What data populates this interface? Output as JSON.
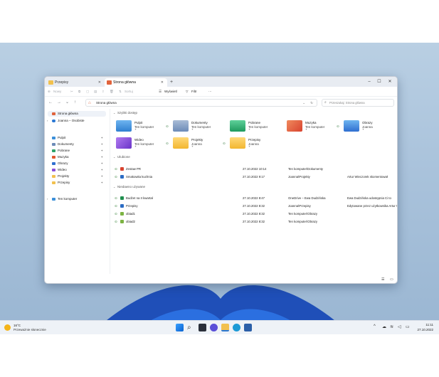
{
  "window": {
    "tabs": [
      {
        "label": "Przepisy",
        "color": "#f2c14e"
      },
      {
        "label": "Strona główna",
        "color": "#e0633c"
      }
    ],
    "new_tab": "+",
    "controls": {
      "minimize": "–",
      "maximize": "☐",
      "close": "✕"
    }
  },
  "commandbar": {
    "new": "Nowy",
    "sort": "Sortuj",
    "view": "Wyświetl",
    "filter": "Filtr",
    "more": "···"
  },
  "address": {
    "path": "Strona główna",
    "search_placeholder": "Przeszukaj: Strona główna"
  },
  "sidebar": {
    "home": "Strona główna",
    "account": "Joanna – Osobiste",
    "quick": [
      {
        "label": "Pulpit",
        "color": "#3b8fd9"
      },
      {
        "label": "Dokumenty",
        "color": "#6c8bb8"
      },
      {
        "label": "Pobrane",
        "color": "#2fa36b"
      },
      {
        "label": "Muzyka",
        "color": "#e0572f"
      },
      {
        "label": "Obrazy",
        "color": "#2f6fd0"
      },
      {
        "label": "Wideo",
        "color": "#8a4fd8"
      },
      {
        "label": "Projekty",
        "color": "#f2c14e"
      },
      {
        "label": "Przepisy",
        "color": "#f2c14e"
      }
    ],
    "computer": "Ten komputer"
  },
  "sections": {
    "quick_access": "Szybki dostęp",
    "favorites": "Ulubione",
    "recent": "Niedawno używane"
  },
  "quick_tiles": [
    {
      "name": "Pulpit",
      "sub": "Ten komputer",
      "color": "#3b8fd9"
    },
    {
      "name": "Dokumenty",
      "sub": "Ten komputer",
      "color": "#6c8bb8"
    },
    {
      "name": "Pobrane",
      "sub": "Ten komputer",
      "color": "#2fa36b"
    },
    {
      "name": "Muzyka",
      "sub": "Ten komputer",
      "color": "#e0572f"
    },
    {
      "name": "Obrazy",
      "sub": "Joanna",
      "color": "#2f6fd0"
    },
    {
      "name": "Wideo",
      "sub": "Ten komputer",
      "color": "#8a4fd8"
    },
    {
      "name": "Projekty",
      "sub": "Joanna",
      "color": "#f2c14e"
    },
    {
      "name": "Przepisy",
      "sub": "Joanna",
      "color": "#f2c14e"
    }
  ],
  "favorites": [
    {
      "name": "Zestaw PR",
      "date": "27.10.2022 10:14",
      "location": "Ten komputer\\Dokumenty",
      "activity": "",
      "color": "#d8432f"
    },
    {
      "name": "Smakowita kuchnia",
      "date": "27.10.2022 9:17",
      "location": "Joanna\\Projekty",
      "activity": "Artur Wieczorek skomentował",
      "color": "#2b6cc4"
    }
  ],
  "recent": [
    {
      "name": "Budżet na II kwartał",
      "date": "27.10.2022 8:47",
      "location": "OneDrive – Ewa Dudzińska",
      "activity": "Ewa Dudzińska udostępnia Ci to",
      "color": "#1f8f4e"
    },
    {
      "name": "Przepisy",
      "date": "27.10.2022 8:32",
      "location": "Joanna\\Przepisy",
      "activity": "Edytowane przez użytkownika Artur Wieczorek",
      "color": "#2b6cc4"
    },
    {
      "name": "obiad1",
      "date": "27.10.2022 8:32",
      "location": "Ten komputer\\Obrazy",
      "activity": "",
      "color": "#7cb342"
    },
    {
      "name": "obiad2",
      "date": "27.10.2022 8:32",
      "location": "Ten komputer\\Obrazy",
      "activity": "",
      "color": "#7cb342"
    }
  ],
  "taskbar": {
    "weather_temp": "16°C",
    "weather_desc": "Przeważnie słonecznie",
    "time": "11:11",
    "date": "27.10.2022"
  }
}
